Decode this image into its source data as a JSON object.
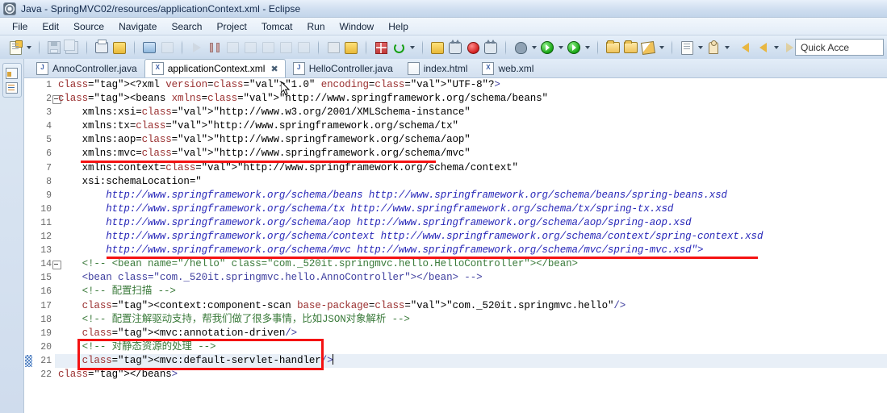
{
  "window": {
    "title": "Java - SpringMVC02/resources/applicationContext.xml - Eclipse",
    "app_icon": "eclipse-icon"
  },
  "menubar": {
    "items": [
      {
        "label": "File"
      },
      {
        "label": "Edit"
      },
      {
        "label": "Source"
      },
      {
        "label": "Navigate"
      },
      {
        "label": "Search"
      },
      {
        "label": "Project"
      },
      {
        "label": "Tomcat"
      },
      {
        "label": "Run"
      },
      {
        "label": "Window"
      },
      {
        "label": "Help"
      }
    ]
  },
  "toolbar": {
    "quick_access_value": "Quick Acce",
    "groups": [
      {
        "name": "new-group",
        "buttons": [
          {
            "name": "new-wizard-button",
            "icon": "new-document-icon",
            "dropdown": true
          }
        ]
      },
      {
        "name": "save-group",
        "buttons": [
          {
            "name": "save-button",
            "icon": "save-icon",
            "dropdown": false
          },
          {
            "name": "save-all-button",
            "icon": "save-all-icon",
            "dropdown": false
          }
        ]
      },
      {
        "name": "print-group",
        "buttons": [
          {
            "name": "print-button",
            "icon": "print-icon",
            "dropdown": false
          },
          {
            "name": "validate-button",
            "icon": "validate-icon",
            "dropdown": false
          }
        ]
      },
      {
        "name": "console-group",
        "buttons": [
          {
            "name": "open-console-button",
            "icon": "console-icon",
            "dropdown": false
          },
          {
            "name": "skip-breakpoints-button",
            "icon": "skip-breakpoints-icon",
            "dropdown": false
          }
        ]
      },
      {
        "name": "debug-control-group",
        "buttons": [
          {
            "name": "resume-button",
            "icon": "resume-icon",
            "dropdown": false
          },
          {
            "name": "suspend-button",
            "icon": "suspend-icon",
            "dropdown": false
          },
          {
            "name": "terminate-button",
            "icon": "terminate-icon",
            "dropdown": false
          },
          {
            "name": "disconnect-button",
            "icon": "disconnect-icon",
            "dropdown": false
          },
          {
            "name": "step-into-button",
            "icon": "step-into-icon",
            "dropdown": false
          },
          {
            "name": "step-over-button",
            "icon": "step-over-icon",
            "dropdown": false
          },
          {
            "name": "step-return-button",
            "icon": "step-return-icon",
            "dropdown": false
          }
        ]
      },
      {
        "name": "server-group",
        "buttons": [
          {
            "name": "new-server-button",
            "icon": "server-icon",
            "dropdown": false
          },
          {
            "name": "publish-button",
            "icon": "publish-icon",
            "dropdown": false
          }
        ]
      },
      {
        "name": "tomcat-group",
        "buttons": [
          {
            "name": "start-tomcat-button",
            "icon": "tomcat-start-icon",
            "dropdown": false
          },
          {
            "name": "refresh-button",
            "icon": "refresh-icon",
            "dropdown": true
          }
        ]
      },
      {
        "name": "tomcat-actions-group",
        "buttons": [
          {
            "name": "tomcat-config-button",
            "icon": "tomcat-config-icon",
            "dropdown": false
          },
          {
            "name": "tomcat-stop-button",
            "icon": "tomcat-stop-icon",
            "dropdown": false
          },
          {
            "name": "tomcat-kill-button",
            "icon": "tomcat-kill-icon",
            "dropdown": false
          },
          {
            "name": "tomcat-restart-button",
            "icon": "tomcat-restart-icon",
            "dropdown": false
          }
        ]
      },
      {
        "name": "run-debug-group",
        "buttons": [
          {
            "name": "debug-button",
            "icon": "debug-bug-icon",
            "dropdown": true
          },
          {
            "name": "run-button",
            "icon": "run-green-icon",
            "dropdown": true
          },
          {
            "name": "run-external-tools-button",
            "icon": "external-tools-icon",
            "dropdown": true
          }
        ]
      },
      {
        "name": "open-group",
        "buttons": [
          {
            "name": "open-type-button",
            "icon": "open-type-icon",
            "dropdown": false
          },
          {
            "name": "open-resource-button",
            "icon": "open-folder-icon",
            "dropdown": false
          },
          {
            "name": "new-java-class-button",
            "icon": "pen-icon",
            "dropdown": true
          }
        ]
      },
      {
        "name": "search-group",
        "buttons": [
          {
            "name": "search-button",
            "icon": "search-doc-icon",
            "dropdown": true
          },
          {
            "name": "task-button",
            "icon": "task-person-icon",
            "dropdown": true
          }
        ]
      },
      {
        "name": "nav-group",
        "buttons": [
          {
            "name": "previous-edit-button",
            "icon": "arrow-left-yellow-icon",
            "dropdown": false
          },
          {
            "name": "back-button",
            "icon": "back-arrow-icon",
            "dropdown": true
          },
          {
            "name": "forward-button",
            "icon": "forward-arrow-icon",
            "dropdown": true
          }
        ]
      }
    ]
  },
  "fastview": {
    "items": [
      {
        "name": "restore-perspective-button",
        "icon": "perspective-icon"
      },
      {
        "name": "outline-view-button",
        "icon": "outline-icon"
      }
    ]
  },
  "editor": {
    "tabs": [
      {
        "label": "AnnoController.java",
        "icon": "java-file-icon",
        "icon_letter": "J",
        "active": false,
        "closable": false
      },
      {
        "label": "applicationContext.xml",
        "icon": "xml-file-icon",
        "icon_letter": "X",
        "active": true,
        "closable": true,
        "close_glyph": "✖"
      },
      {
        "label": "HelloController.java",
        "icon": "java-file-icon",
        "icon_letter": "J",
        "active": false,
        "closable": false
      },
      {
        "label": "index.html",
        "icon": "html-file-icon",
        "icon_letter": "",
        "active": false,
        "closable": false
      },
      {
        "label": "web.xml",
        "icon": "xml-file-icon",
        "icon_letter": "X",
        "active": false,
        "closable": false
      }
    ],
    "current_line": 21,
    "lines": [
      {
        "num": "1",
        "fold": false,
        "change": false,
        "text": "<?xml version=\"1.0\" encoding=\"UTF-8\"?>"
      },
      {
        "num": "2",
        "fold": true,
        "change": false,
        "text": "<beans xmlns=\"http://www.springframework.org/schema/beans\""
      },
      {
        "num": "3",
        "fold": false,
        "change": false,
        "text": "    xmlns:xsi=\"http://www.w3.org/2001/XMLSchema-instance\""
      },
      {
        "num": "4",
        "fold": false,
        "change": false,
        "text": "    xmlns:tx=\"http://www.springframework.org/schema/tx\""
      },
      {
        "num": "5",
        "fold": false,
        "change": false,
        "text": "    xmlns:aop=\"http://www.springframework.org/schema/aop\""
      },
      {
        "num": "6",
        "fold": false,
        "change": false,
        "text": "    xmlns:mvc=\"http://www.springframework.org/schema/mvc\""
      },
      {
        "num": "7",
        "fold": false,
        "change": false,
        "text": "    xmlns:context=\"http://www.springframework.org/schema/context\""
      },
      {
        "num": "8",
        "fold": false,
        "change": false,
        "text": "    xsi:schemaLocation=\""
      },
      {
        "num": "9",
        "fold": false,
        "change": false,
        "text": "        http://www.springframework.org/schema/beans http://www.springframework.org/schema/beans/spring-beans.xsd"
      },
      {
        "num": "10",
        "fold": false,
        "change": false,
        "text": "        http://www.springframework.org/schema/tx http://www.springframework.org/schema/tx/spring-tx.xsd"
      },
      {
        "num": "11",
        "fold": false,
        "change": false,
        "text": "        http://www.springframework.org/schema/aop http://www.springframework.org/schema/aop/spring-aop.xsd"
      },
      {
        "num": "12",
        "fold": false,
        "change": false,
        "text": "        http://www.springframework.org/schema/context http://www.springframework.org/schema/context/spring-context.xsd"
      },
      {
        "num": "13",
        "fold": false,
        "change": false,
        "text": "        http://www.springframework.org/schema/mvc http://www.springframework.org/schema/mvc/spring-mvc.xsd\">"
      },
      {
        "num": "14",
        "fold": true,
        "change": false,
        "text": "    <!-- <bean name=\"/hello\" class=\"com._520it.springmvc.hello.HelloController\"></bean>"
      },
      {
        "num": "15",
        "fold": false,
        "change": false,
        "text": "    <bean class=\"com._520it.springmvc.hello.AnnoController\"></bean> -->"
      },
      {
        "num": "16",
        "fold": false,
        "change": false,
        "text": "    <!-- 配置扫描 -->"
      },
      {
        "num": "17",
        "fold": false,
        "change": false,
        "text": "    <context:component-scan base-package=\"com._520it.springmvc.hello\"/>"
      },
      {
        "num": "18",
        "fold": false,
        "change": false,
        "text": "    <!-- 配置注解驱动支持，帮我们做了很多事情，比如JSON对象解析 -->"
      },
      {
        "num": "19",
        "fold": false,
        "change": false,
        "text": "    <mvc:annotation-driven/>"
      },
      {
        "num": "20",
        "fold": false,
        "change": false,
        "text": "    <!-- 对静态资源的处理 -->"
      },
      {
        "num": "21",
        "fold": false,
        "change": true,
        "text": "    <mvc:default-servlet-handler/>"
      },
      {
        "num": "22",
        "fold": false,
        "change": false,
        "text": "</beans>"
      }
    ]
  },
  "annotations": {
    "color": "#f41212",
    "underlines": [
      {
        "name": "redline-xmlns-mvc",
        "target_line": 6
      },
      {
        "name": "redline-schemalocation-mvc",
        "target_line": 13
      }
    ],
    "boxes": [
      {
        "name": "redbox-default-servlet-handler",
        "target_lines": [
          20,
          21
        ]
      }
    ]
  },
  "cursor": {
    "name": "mouse-pointer",
    "over_line": 1
  }
}
